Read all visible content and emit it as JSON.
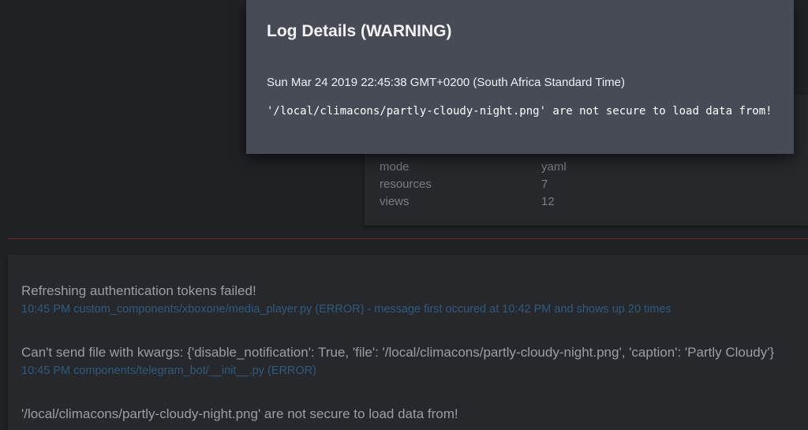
{
  "dialog": {
    "title": "Log Details (WARNING)",
    "timestamp": "Sun Mar 24 2019 22:45:38 GMT+0200 (South Africa Standard Time)",
    "message": "'/local/climacons/partly-cloudy-night.png' are not secure to load data from!"
  },
  "info": {
    "rows": [
      {
        "key": "mode",
        "value": "yaml"
      },
      {
        "key": "resources",
        "value": "7"
      },
      {
        "key": "views",
        "value": "12"
      }
    ]
  },
  "logs": [
    {
      "message": "Refreshing authentication tokens failed!",
      "meta": "10:45 PM custom_components/xboxone/media_player.py (ERROR) - message first occured at 10:42 PM and shows up 20 times"
    },
    {
      "message": "Can't send file with kwargs: {'disable_notification': True, 'file': '/local/climacons/partly-cloudy-night.png', 'caption': 'Partly Cloudy'}",
      "meta": "10:45 PM components/telegram_bot/__init__.py (ERROR)"
    },
    {
      "message": "'/local/climacons/partly-cloudy-night.png' are not secure to load data from!",
      "meta": ""
    }
  ],
  "colors": {
    "background": "#1f2125",
    "card": "#26282c",
    "dialog": "#464b56",
    "meta_link": "#2f5a80",
    "divider": "#6b2a27"
  }
}
